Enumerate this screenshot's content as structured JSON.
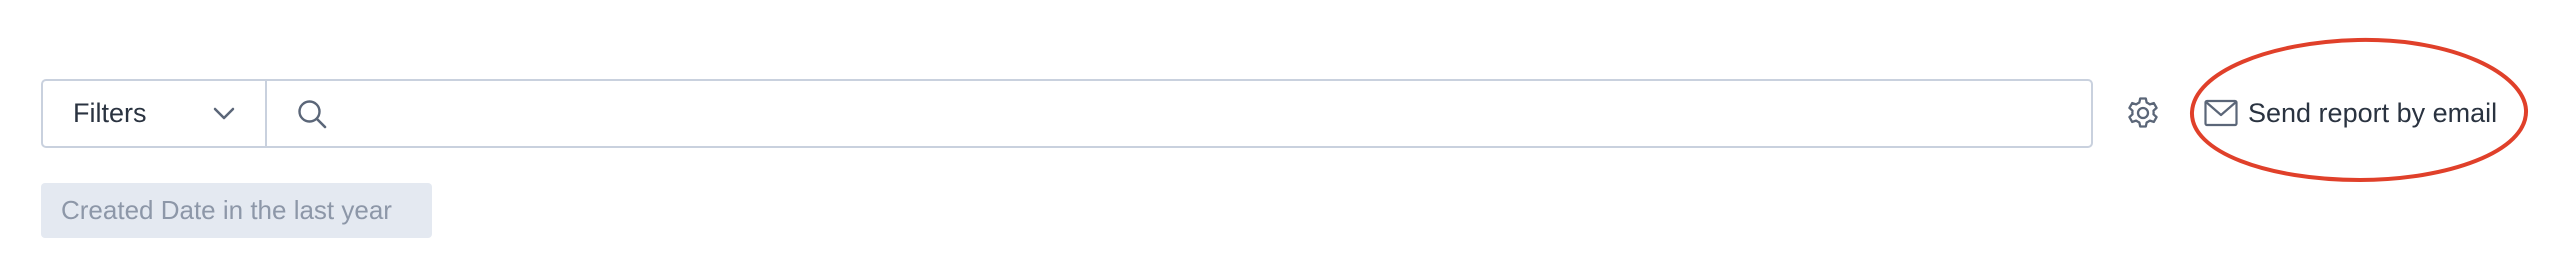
{
  "filter_bar": {
    "filters_label": "Filters",
    "search_placeholder": "",
    "search_value": ""
  },
  "actions": {
    "email_label": "Send report by email"
  },
  "active_filters": [
    {
      "label": "Created Date in the last year"
    }
  ],
  "icons": {
    "chevron": "chevron-down-icon",
    "search": "search-icon",
    "gear": "gear-icon",
    "mail": "mail-icon"
  },
  "colors": {
    "border": "#c9d1de",
    "text": "#2a3340",
    "chip_bg": "#e4e9f1",
    "chip_text": "#8d97a8",
    "highlight": "#e0402a"
  }
}
